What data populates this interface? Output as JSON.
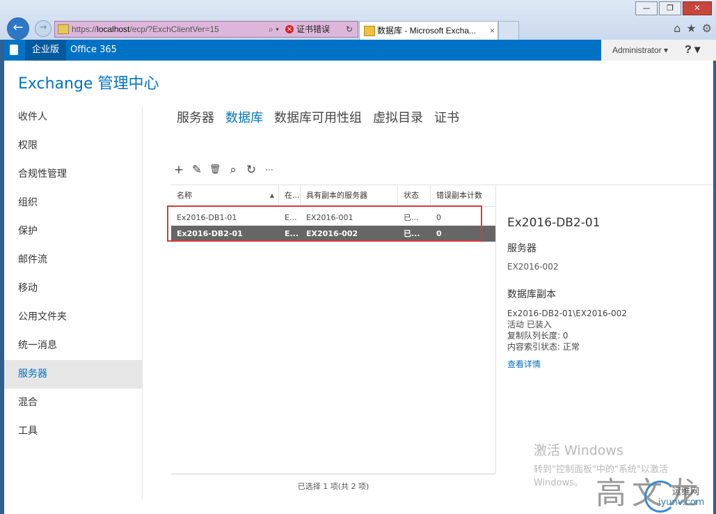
{
  "browser": {
    "url_prefix": "https://",
    "url_host": "localhost",
    "url_path": "/ecp/?ExchClientVer=15",
    "cert_error": "证书错误",
    "tab_title": "数据库 - Microsoft Excha...",
    "tab_close": "×",
    "window_buttons": [
      "—",
      "❐",
      "✕"
    ]
  },
  "topbar": {
    "enterprise": "企业版",
    "office365": "Office 365",
    "user": "Administrator ▾",
    "help": "? ▾"
  },
  "app_title": "Exchange 管理中心",
  "leftnav": {
    "items": [
      "收件人",
      "权限",
      "合规性管理",
      "组织",
      "保护",
      "邮件流",
      "移动",
      "公用文件夹",
      "统一消息",
      "服务器",
      "混合",
      "工具"
    ],
    "active_index": 9
  },
  "subtabs": {
    "items": [
      "服务器",
      "数据库",
      "数据库可用性组",
      "虚拟目录",
      "证书"
    ],
    "active_index": 1
  },
  "toolbar": {
    "add": "+",
    "edit": "✎",
    "delete": "🗑",
    "search": "⌕",
    "refresh": "↻",
    "more": "···"
  },
  "table": {
    "headers": [
      "名称",
      "在...",
      "具有副本的服务器",
      "状态",
      "错误副本计数"
    ],
    "rows": [
      {
        "name": "Ex2016-DB1-01",
        "on": "E...",
        "servers": "EX2016-001",
        "status": "已...",
        "bad": "0",
        "selected": false
      },
      {
        "name": "Ex2016-DB2-01",
        "on": "E...",
        "servers": "EX2016-002",
        "status": "已...",
        "bad": "0",
        "selected": true
      }
    ],
    "status_text": "已选择 1 项(共 2 项)"
  },
  "details": {
    "title": "Ex2016-DB2-01",
    "server_label": "服务器",
    "server_value": "EX2016-002",
    "copies_label": "数据库副本",
    "copy_lines": [
      "Ex2016-DB2-01\\EX2016-002",
      "活动 已装入",
      "复制队列长度: 0",
      "内容索引状态: 正常"
    ],
    "link": "查看详情"
  },
  "watermark": {
    "activate_title": "激活 Windows",
    "activate_line1": "转到\"控制面板\"中的\"系统\"以激活",
    "activate_line2": "Windows。",
    "brand": "高文龙",
    "site_cn": "运维网",
    "site": "iyunv.com"
  }
}
